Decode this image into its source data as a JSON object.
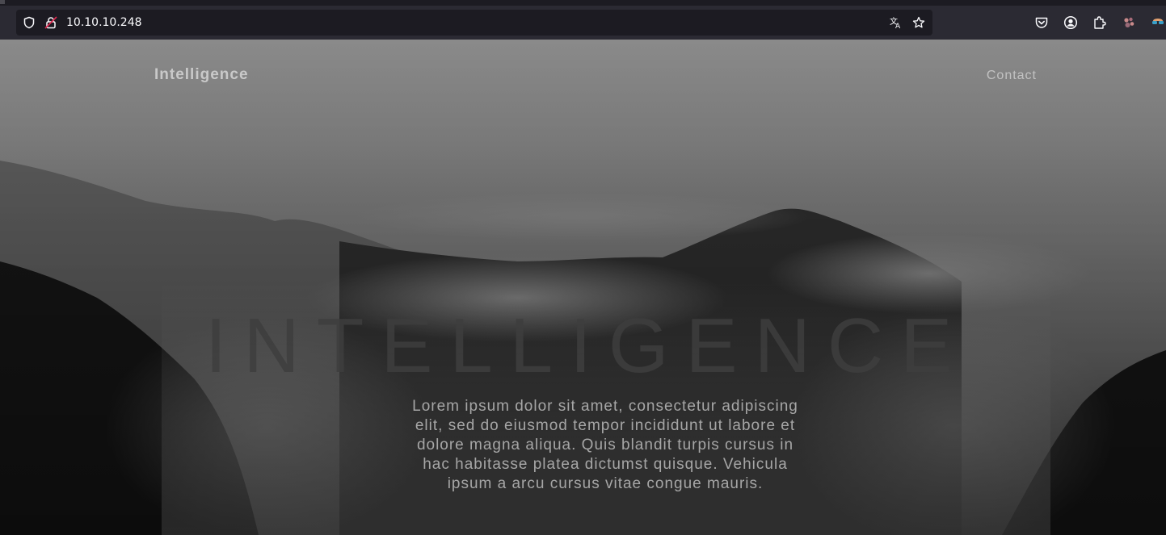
{
  "browser": {
    "url": "10.10.10.248",
    "icons": {
      "tracking": "shield-icon",
      "connection": "insecure-lock-icon",
      "translate": "translate-icon",
      "bookmark": "star-icon",
      "pocket": "pocket-icon",
      "account": "account-icon",
      "extensions": "extensions-icon",
      "ext1": "paw-extension-icon",
      "ext2": "glasses-extension-icon"
    }
  },
  "site": {
    "brand": "Intelligence",
    "nav": {
      "contact": "Contact"
    },
    "hero": {
      "title": "INTELLIGENCE",
      "text": "Lorem ipsum dolor sit amet, consectetur adipiscing elit, sed do eiusmod tempor incididunt ut labore et dolore magna aliqua. Quis blandit turpis cursus in hac habitasse platea dictumst quisque. Vehicula ipsum a arcu cursus vitae congue mauris."
    }
  },
  "colors": {
    "toolbar": "#2b2a33",
    "urlbar": "#1c1b22",
    "accent_lock": "#e22850"
  }
}
